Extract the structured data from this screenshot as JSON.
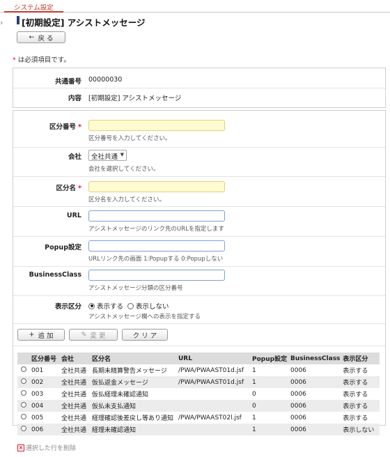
{
  "tab": {
    "label": "システム設定"
  },
  "header": {
    "title": "[初期設定] アシストメッセージ",
    "back_label": "戻 る"
  },
  "required_note": {
    "mark": "*",
    "text": "は必須項目です。"
  },
  "info": {
    "common_no_label": "共通番号",
    "common_no_value": "00000030",
    "content_label": "内容",
    "content_value": "[初期設定] アシストメッセージ"
  },
  "form": {
    "category_no": {
      "label": "区分番号",
      "required": "*",
      "value": "",
      "hint": "区分番号を入力してください。"
    },
    "company": {
      "label": "会社",
      "selected": "全社共通",
      "hint": "会社を選択してください。"
    },
    "category_name": {
      "label": "区分名",
      "required": "*",
      "value": "",
      "hint": "区分名を入力してください。"
    },
    "url": {
      "label": "URL",
      "value": "",
      "hint": "アシストメッセージのリンク先のURLを指定します"
    },
    "popup": {
      "label": "Popup設定",
      "value": "",
      "hint": "URLリンク先の画面 1:Popupする 0:Popupしない"
    },
    "business_class": {
      "label": "BusinessClass",
      "value": "",
      "hint": "アシストメッセージ分類の区分番号"
    },
    "display": {
      "label": "表示区分",
      "option_show": "表示する",
      "option_hide": "表示しない",
      "selected": "show",
      "hint": "アシストメッセージ欄への表示を指定する"
    }
  },
  "actions": {
    "add": "追 加",
    "edit": "変 更",
    "clear": "ク リ ア"
  },
  "table": {
    "headers": [
      "",
      "区分番号",
      "会社",
      "区分名",
      "URL",
      "Popup設定",
      "BusinessClass",
      "表示区分"
    ],
    "rows": [
      [
        "",
        "001",
        "全社共通",
        "長期未精算警告メッセージ",
        "/PWA/PWAAST01d.jsf",
        "1",
        "0006",
        "表示する"
      ],
      [
        "",
        "002",
        "全社共通",
        "仮払返金メッセージ",
        "/PWA/PWAAST01d.jsf",
        "1",
        "0006",
        "表示する"
      ],
      [
        "",
        "003",
        "全社共通",
        "仮払経理未確認通知",
        "",
        "0",
        "0006",
        "表示する"
      ],
      [
        "",
        "004",
        "全社共通",
        "仮払未支払通知",
        "",
        "0",
        "0006",
        "表示する"
      ],
      [
        "",
        "005",
        "全社共通",
        "経理確認後差戻し等あり通知",
        "/PWA/PWAAST02l.jsf",
        "1",
        "0006",
        "表示する"
      ],
      [
        "",
        "006",
        "全社共通",
        "経理未確認通知",
        "",
        "1",
        "0006",
        "表示しない"
      ]
    ]
  },
  "delete_label": "選択した行を削除"
}
